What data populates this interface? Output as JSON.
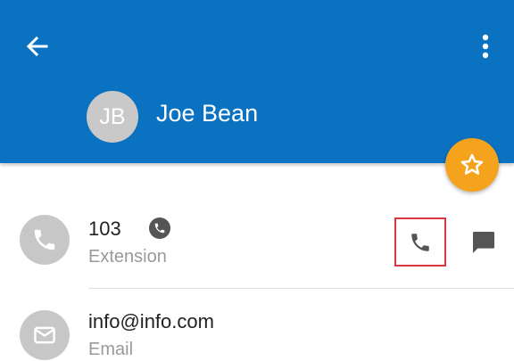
{
  "header": {
    "back_icon": "arrow-left-icon",
    "menu_icon": "more-vertical-icon",
    "background_color": "#0b72c1"
  },
  "contact": {
    "initials": "JB",
    "name": "Joe Bean"
  },
  "favorite": {
    "icon": "star-outline-icon",
    "color": "#f5a31d"
  },
  "details": [
    {
      "icon": "phone-icon",
      "value": "103",
      "label": "Extension",
      "actions": [
        "phone-icon",
        "message-icon"
      ]
    },
    {
      "icon": "mail-icon",
      "value": "info@info.com",
      "label": "Email"
    }
  ],
  "highlight_color": "#d9363e"
}
